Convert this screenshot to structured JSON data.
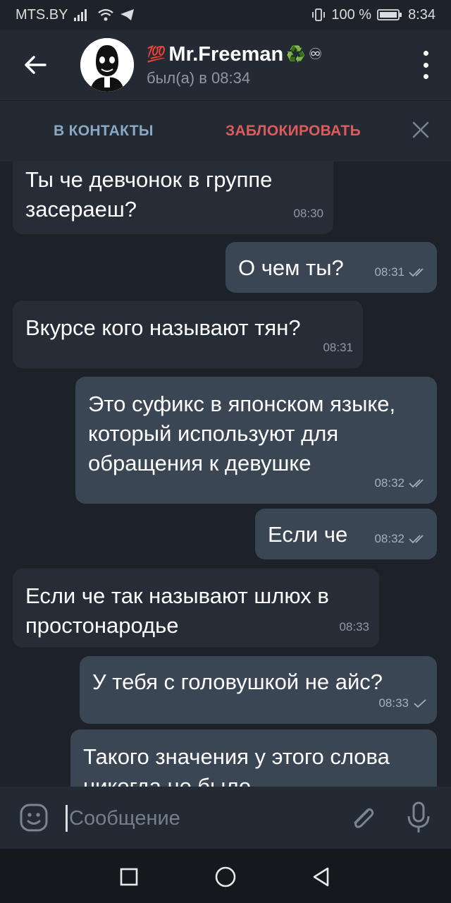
{
  "status_bar": {
    "carrier": "MTS.BY",
    "battery": "100 %",
    "time": "8:34"
  },
  "header": {
    "name_prefix_emoji": "💯",
    "name": "Mr.Freeman",
    "name_suffix_emoji": "♻️",
    "name_suffix_symbol": "♾",
    "last_seen": "был(а) в 08:34"
  },
  "action_bar": {
    "add_contact": "В КОНТАКТЫ",
    "block": "ЗАБЛОКИРОВАТЬ"
  },
  "messages": [
    {
      "direction": "in",
      "text": "Ты че девчонок в группе засераеш?",
      "time": "08:30"
    },
    {
      "direction": "out",
      "text": "О чем ты?",
      "time": "08:31",
      "status": "read"
    },
    {
      "direction": "in",
      "text": "Вкурсе кого называют тян?",
      "time": "08:31"
    },
    {
      "direction": "out",
      "text": "Это суфикс в японском языке, который используют для обращения к девушке",
      "time": "08:32",
      "status": "read"
    },
    {
      "direction": "out",
      "text": "Если че",
      "time": "08:32",
      "status": "read"
    },
    {
      "direction": "in",
      "text": "Если че так называют шлюх в простонародье",
      "time": "08:33"
    },
    {
      "direction": "out",
      "text": "У тебя с головушкой не айс?",
      "time": "08:33",
      "status": "sent"
    },
    {
      "direction": "out",
      "text": "Такого значения у этого слова никогда не было",
      "time": "",
      "status": ""
    }
  ],
  "input": {
    "placeholder": "Сообщение"
  },
  "colors": {
    "background": "#1d2128",
    "header": "#232a33",
    "incoming_bubble": "#262d37",
    "outgoing_bubble": "#3b4655",
    "block_red": "#e05a5a",
    "contact_blue": "#8aa7c4"
  },
  "icons": {
    "back": "arrow-left-icon",
    "menu": "more-vertical-icon",
    "close": "close-icon",
    "emoji": "emoji-icon",
    "attach": "paperclip-icon",
    "mic": "microphone-icon",
    "nav_recent": "square-icon",
    "nav_home": "circle-icon",
    "nav_back": "triangle-back-icon"
  }
}
